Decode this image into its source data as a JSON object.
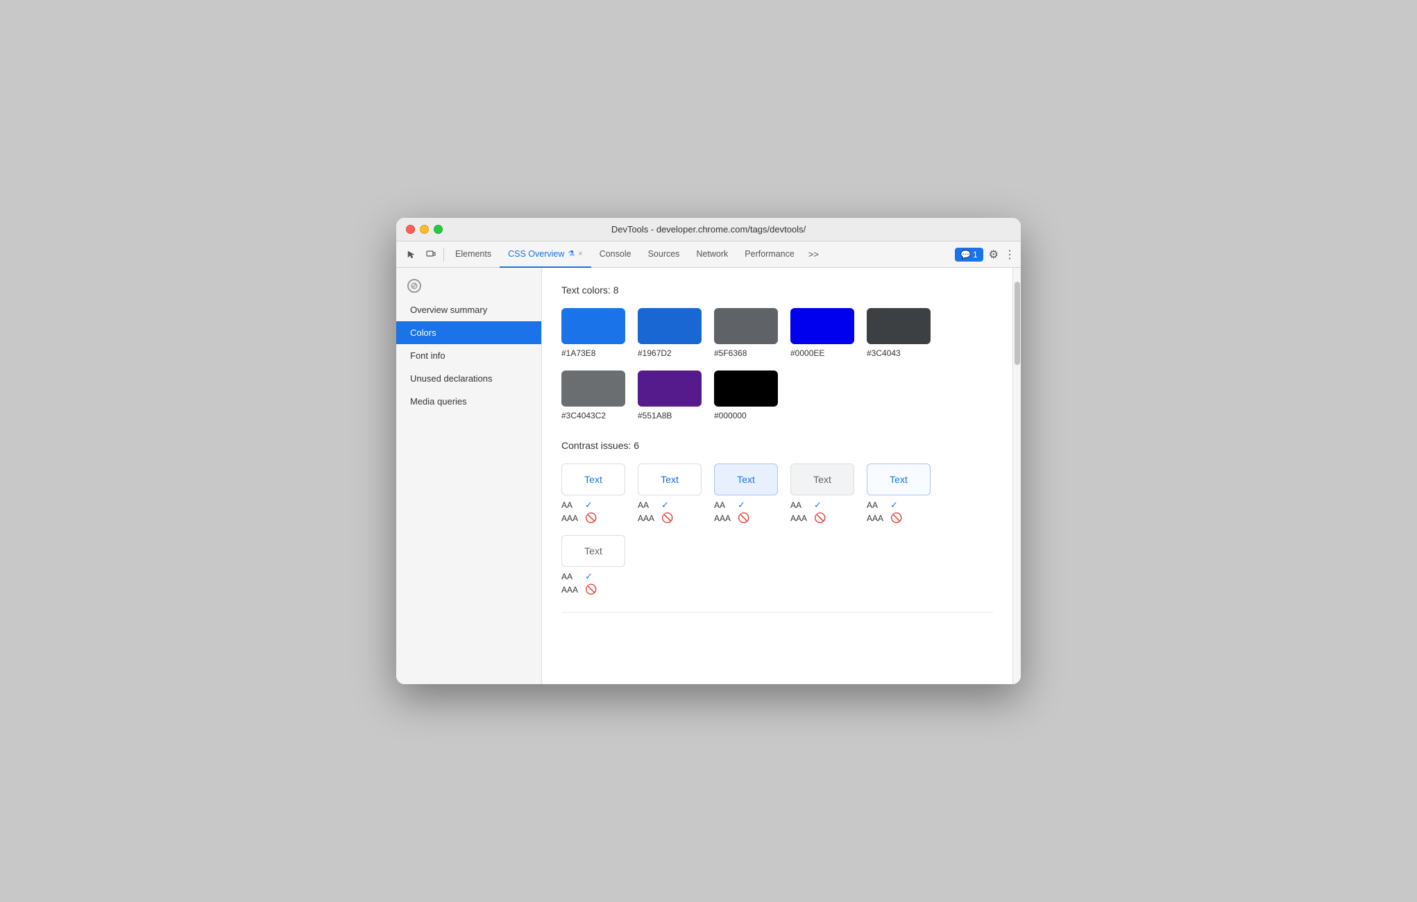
{
  "window": {
    "title": "DevTools - developer.chrome.com/tags/devtools/"
  },
  "toolbar": {
    "tabs": [
      {
        "label": "Elements",
        "active": false
      },
      {
        "label": "CSS Overview",
        "active": true
      },
      {
        "label": "Console",
        "active": false
      },
      {
        "label": "Sources",
        "active": false
      },
      {
        "label": "Network",
        "active": false
      },
      {
        "label": "Performance",
        "active": false
      }
    ],
    "more_label": ">>",
    "chat_label": "1",
    "close_tab_label": "×"
  },
  "sidebar": {
    "items": [
      {
        "label": "Overview summary",
        "active": false
      },
      {
        "label": "Colors",
        "active": true
      },
      {
        "label": "Font info",
        "active": false
      },
      {
        "label": "Unused declarations",
        "active": false
      },
      {
        "label": "Media queries",
        "active": false
      }
    ]
  },
  "colors_section": {
    "title": "Text colors: 8",
    "colors": [
      {
        "hex": "#1A73E8",
        "value": "#1A73E8"
      },
      {
        "hex": "#1967D2",
        "value": "#1967D2"
      },
      {
        "hex": "#5F6368",
        "value": "#5F6368"
      },
      {
        "hex": "#0000EE",
        "value": "#0000EE"
      },
      {
        "hex": "#3C4043",
        "value": "#3C4043"
      },
      {
        "hex": "#3C4043C2",
        "value": "#3C4043C2"
      },
      {
        "hex": "#551A8B",
        "value": "#551A8B"
      },
      {
        "hex": "#000000",
        "value": "#000000"
      }
    ]
  },
  "contrast_section": {
    "title": "Contrast issues: 6",
    "items": [
      {
        "text_label": "Text",
        "text_color": "#1a73e8",
        "bg_color": "#ffffff",
        "border_color": "#ddd",
        "aa_pass": true,
        "aaa_pass": false
      },
      {
        "text_label": "Text",
        "text_color": "#1967d2",
        "bg_color": "#ffffff",
        "border_color": "#ddd",
        "aa_pass": true,
        "aaa_pass": false
      },
      {
        "text_label": "Text",
        "text_color": "#1a73e8",
        "bg_color": "#e8f0fe",
        "border_color": "#aac4f0",
        "aa_pass": true,
        "aaa_pass": false
      },
      {
        "text_label": "Text",
        "text_color": "#5f6368",
        "bg_color": "#f1f3f4",
        "border_color": "#ddd",
        "aa_pass": true,
        "aaa_pass": false
      },
      {
        "text_label": "Text",
        "text_color": "#1a73e8",
        "bg_color": "#f8fbff",
        "border_color": "#aac4f0",
        "aa_pass": true,
        "aaa_pass": false
      },
      {
        "text_label": "Text",
        "text_color": "#5f6368",
        "bg_color": "#ffffff",
        "border_color": "#ddd",
        "aa_pass": true,
        "aaa_pass": false
      }
    ]
  }
}
